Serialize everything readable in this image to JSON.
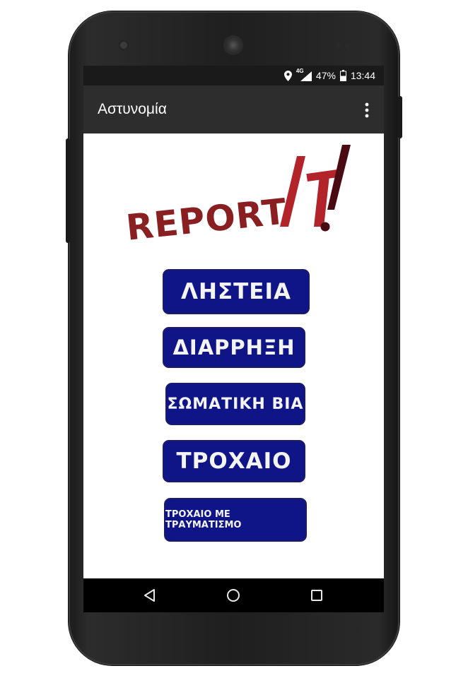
{
  "status_bar": {
    "network": "4G",
    "battery": "47%",
    "time": "13:44",
    "icons": [
      "location-icon",
      "signal-icon",
      "battery-icon"
    ]
  },
  "app_bar": {
    "title": "Αστυνομία",
    "menu_icon": "overflow-menu-icon"
  },
  "logo": {
    "text": "REPORT",
    "suffix": "IT!",
    "colors": {
      "report": "#8a1f22",
      "slash": "#b3232a",
      "exclaim": "#4a0a12"
    }
  },
  "buttons": [
    {
      "label": "ΛΗΣΤΕΙΑ"
    },
    {
      "label": "ΔΙΑΡΡΗΞΗ"
    },
    {
      "label": "ΣΩΜΑΤΙΚΗ ΒΙΑ"
    },
    {
      "label": "ΤΡΟΧΑΙΟ"
    },
    {
      "label": "ΤΡΟΧΑΙΟ ΜΕ ΤΡΑΥΜΑΤΙΣΜΟ"
    }
  ],
  "nav_bar": {
    "back": "back-icon",
    "home": "home-icon",
    "recents": "recents-icon"
  },
  "colors": {
    "button_bg": "#0f1486",
    "status_bar": "#1a1a1a",
    "app_bar": "#2d2d2d"
  }
}
